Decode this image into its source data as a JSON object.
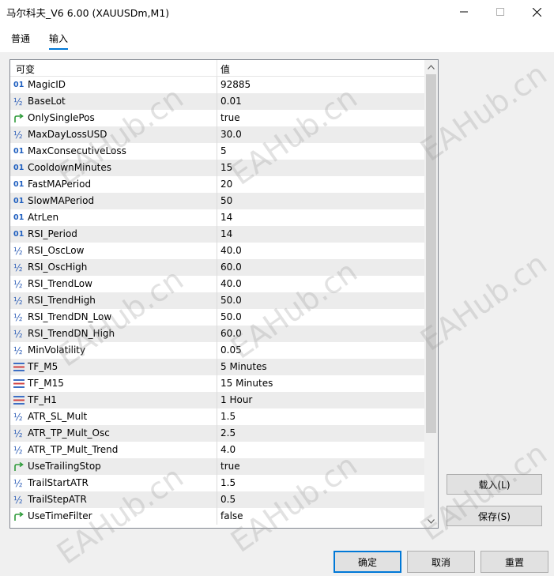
{
  "window": {
    "title": "马尔科夫_V6 6.00 (XAUUSDm,M1)"
  },
  "tabs": [
    {
      "label": "普通"
    },
    {
      "label": "输入"
    }
  ],
  "grid": {
    "header": {
      "name": "可变",
      "value": "值"
    },
    "rows": [
      {
        "icon": "int-icon",
        "name": "MagicID",
        "value": "92885"
      },
      {
        "icon": "double-icon",
        "name": "BaseLot",
        "value": "0.01"
      },
      {
        "icon": "bool-icon",
        "name": "OnlySinglePos",
        "value": "true"
      },
      {
        "icon": "double-icon",
        "name": "MaxDayLossUSD",
        "value": "30.0"
      },
      {
        "icon": "int-icon",
        "name": "MaxConsecutiveLoss",
        "value": "5"
      },
      {
        "icon": "int-icon",
        "name": "CooldownMinutes",
        "value": "15"
      },
      {
        "icon": "int-icon",
        "name": "FastMAPeriod",
        "value": "20"
      },
      {
        "icon": "int-icon",
        "name": "SlowMAPeriod",
        "value": "50"
      },
      {
        "icon": "int-icon",
        "name": "AtrLen",
        "value": "14"
      },
      {
        "icon": "int-icon",
        "name": "RSI_Period",
        "value": "14"
      },
      {
        "icon": "double-icon",
        "name": "RSI_OscLow",
        "value": "40.0"
      },
      {
        "icon": "double-icon",
        "name": "RSI_OscHigh",
        "value": "60.0"
      },
      {
        "icon": "double-icon",
        "name": "RSI_TrendLow",
        "value": "40.0"
      },
      {
        "icon": "double-icon",
        "name": "RSI_TrendHigh",
        "value": "50.0"
      },
      {
        "icon": "double-icon",
        "name": "RSI_TrendDN_Low",
        "value": "50.0"
      },
      {
        "icon": "double-icon",
        "name": "RSI_TrendDN_High",
        "value": "60.0"
      },
      {
        "icon": "double-icon",
        "name": "MinVolatility",
        "value": "0.05"
      },
      {
        "icon": "enum-icon",
        "name": "TF_M5",
        "value": "5 Minutes"
      },
      {
        "icon": "enum-icon",
        "name": "TF_M15",
        "value": "15 Minutes"
      },
      {
        "icon": "enum-icon",
        "name": "TF_H1",
        "value": "1 Hour"
      },
      {
        "icon": "double-icon",
        "name": "ATR_SL_Mult",
        "value": "1.5"
      },
      {
        "icon": "double-icon",
        "name": "ATR_TP_Mult_Osc",
        "value": "2.5"
      },
      {
        "icon": "double-icon",
        "name": "ATR_TP_Mult_Trend",
        "value": "4.0"
      },
      {
        "icon": "bool-icon",
        "name": "UseTrailingStop",
        "value": "true"
      },
      {
        "icon": "double-icon",
        "name": "TrailStartATR",
        "value": "1.5"
      },
      {
        "icon": "double-icon",
        "name": "TrailStepATR",
        "value": "0.5"
      },
      {
        "icon": "bool-icon",
        "name": "UseTimeFilter",
        "value": "false"
      }
    ]
  },
  "buttons": {
    "load": "载入(L)",
    "save": "保存(S)",
    "ok": "确定",
    "cancel": "取消",
    "reset": "重置"
  },
  "watermark": "EAHub.cn",
  "colors": {
    "accent": "#0078d7",
    "row_alt": "#ececec",
    "icon_blue": "#1f5fbf",
    "icon_green": "#2e9b3a"
  }
}
